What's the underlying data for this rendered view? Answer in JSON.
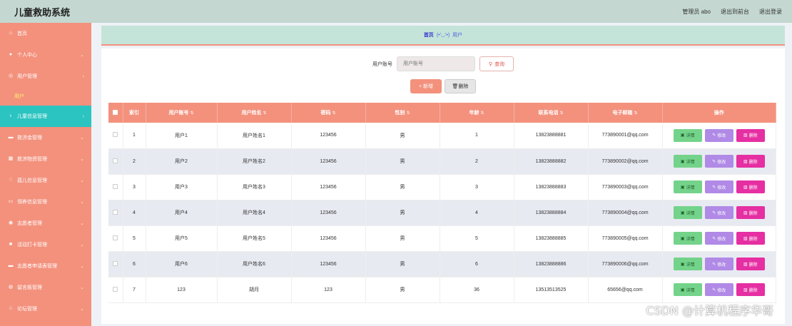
{
  "app": {
    "title": "儿童救助系统",
    "admin_label": "管理员 abo",
    "to_front": "退出到前台",
    "logout": "退出登录"
  },
  "sidebar": {
    "items": [
      {
        "label": "首页",
        "icon": "home-icon"
      },
      {
        "label": "个人中心",
        "icon": "user-icon"
      },
      {
        "label": "用户管理",
        "icon": "users-icon"
      },
      {
        "label": "儿童信息管理",
        "icon": "child-icon",
        "active": true
      },
      {
        "label": "救济金管理",
        "icon": "money-icon"
      },
      {
        "label": "救济物资管理",
        "icon": "box-icon"
      },
      {
        "label": "孤儿信息管理",
        "icon": "orphan-icon"
      },
      {
        "label": "领养信息管理",
        "icon": "adopt-icon"
      },
      {
        "label": "志愿者管理",
        "icon": "volunteer-icon"
      },
      {
        "label": "活动打卡管理",
        "icon": "checkin-icon"
      },
      {
        "label": "志愿者申请表管理",
        "icon": "form-icon"
      },
      {
        "label": "留言板管理",
        "icon": "message-icon"
      },
      {
        "label": "论坛管理",
        "icon": "forum-icon"
      }
    ],
    "sub_item": "用户"
  },
  "breadcrumb": {
    "home": "首页",
    "emote": "(•'◡'•)",
    "current": "用户"
  },
  "search": {
    "label": "用户账号",
    "placeholder": "用户账号",
    "button": "查询"
  },
  "actions": {
    "add": "+ 新增",
    "delete": "删除"
  },
  "table": {
    "headers": [
      "索引",
      "用户账号",
      "用户姓名",
      "密码",
      "性别",
      "年龄",
      "联系电话",
      "电子邮箱",
      "操作"
    ],
    "row_actions": {
      "detail": "详情",
      "edit": "修改",
      "remove": "删除"
    },
    "rows": [
      {
        "idx": "1",
        "account": "用户1",
        "name": "用户姓名1",
        "password": "123456",
        "gender": "男",
        "age": "1",
        "phone": "13823888881",
        "email": "773890001@qq.com"
      },
      {
        "idx": "2",
        "account": "用户2",
        "name": "用户姓名2",
        "password": "123456",
        "gender": "男",
        "age": "2",
        "phone": "13823888882",
        "email": "773890002@qq.com"
      },
      {
        "idx": "3",
        "account": "用户3",
        "name": "用户姓名3",
        "password": "123456",
        "gender": "男",
        "age": "3",
        "phone": "13823888883",
        "email": "773890003@qq.com"
      },
      {
        "idx": "4",
        "account": "用户4",
        "name": "用户姓名4",
        "password": "123456",
        "gender": "男",
        "age": "4",
        "phone": "13823888884",
        "email": "773890004@qq.com"
      },
      {
        "idx": "5",
        "account": "用户5",
        "name": "用户姓名5",
        "password": "123456",
        "gender": "男",
        "age": "5",
        "phone": "13823888885",
        "email": "773890005@qq.com"
      },
      {
        "idx": "6",
        "account": "用户6",
        "name": "用户姓名6",
        "password": "123456",
        "gender": "男",
        "age": "6",
        "phone": "13823888886",
        "email": "773890006@qq.com"
      },
      {
        "idx": "7",
        "account": "123",
        "name": "胡月",
        "password": "123",
        "gender": "男",
        "age": "36",
        "phone": "13513513525",
        "email": "65656@qq.com"
      }
    ]
  },
  "watermark": "CSDN @计算机程序华哥",
  "colors": {
    "header_bg": "#c4d8d1",
    "sidebar_bg": "#f3917d",
    "active_item": "#2bc4c0",
    "table_head": "#f3917d"
  }
}
